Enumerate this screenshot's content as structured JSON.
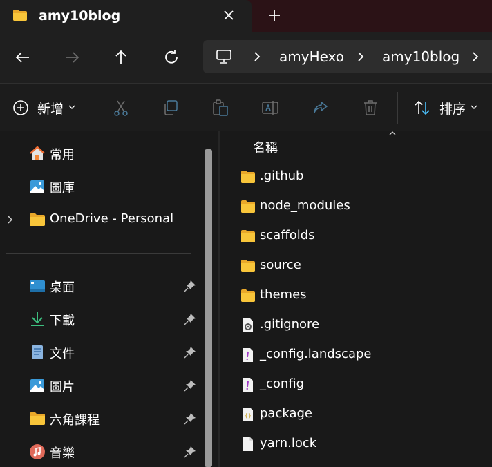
{
  "tab": {
    "title": "amy10blog",
    "close_icon": "close-icon",
    "new_tab_icon": "plus-icon"
  },
  "nav": {
    "back_icon": "arrow-left-icon",
    "forward_icon": "arrow-right-icon",
    "up_icon": "arrow-up-icon",
    "refresh_icon": "refresh-icon",
    "breadcrumbs": [
      "amyHexo",
      "amy10blog"
    ]
  },
  "toolbar": {
    "new_label": "新增",
    "sort_label": "排序",
    "icons": [
      "plus-circle-icon",
      "cut-icon",
      "copy-icon",
      "paste-icon",
      "rename-icon",
      "share-icon",
      "delete-icon",
      "sort-icon"
    ]
  },
  "sidebar": {
    "items": [
      {
        "label": "常用",
        "icon": "home-icon"
      },
      {
        "label": "圖庫",
        "icon": "gallery-icon"
      },
      {
        "label": "OneDrive - Personal",
        "icon": "folder-icon"
      },
      {
        "label": "桌面",
        "icon": "desktop-icon",
        "pinned": true
      },
      {
        "label": "下載",
        "icon": "download-icon",
        "pinned": true
      },
      {
        "label": "文件",
        "icon": "document-icon",
        "pinned": true
      },
      {
        "label": "圖片",
        "icon": "picture-icon",
        "pinned": true
      },
      {
        "label": "六角課程",
        "icon": "folder-icon",
        "pinned": true
      },
      {
        "label": "音樂",
        "icon": "music-icon",
        "pinned": true
      }
    ]
  },
  "content": {
    "column_header": "名稱",
    "files": [
      {
        "name": ".github",
        "type": "folder"
      },
      {
        "name": "node_modules",
        "type": "folder"
      },
      {
        "name": "scaffolds",
        "type": "folder"
      },
      {
        "name": "source",
        "type": "folder"
      },
      {
        "name": "themes",
        "type": "folder"
      },
      {
        "name": ".gitignore",
        "type": "settings-file"
      },
      {
        "name": "_config.landscape",
        "type": "yaml-file"
      },
      {
        "name": "_config",
        "type": "yaml-file"
      },
      {
        "name": "package",
        "type": "json-file"
      },
      {
        "name": "yarn.lock",
        "type": "file"
      }
    ]
  },
  "colors": {
    "accent": "#4cc2ff",
    "folder": "#f8c53a",
    "titlebar": "#2b1216",
    "background": "#191919"
  }
}
